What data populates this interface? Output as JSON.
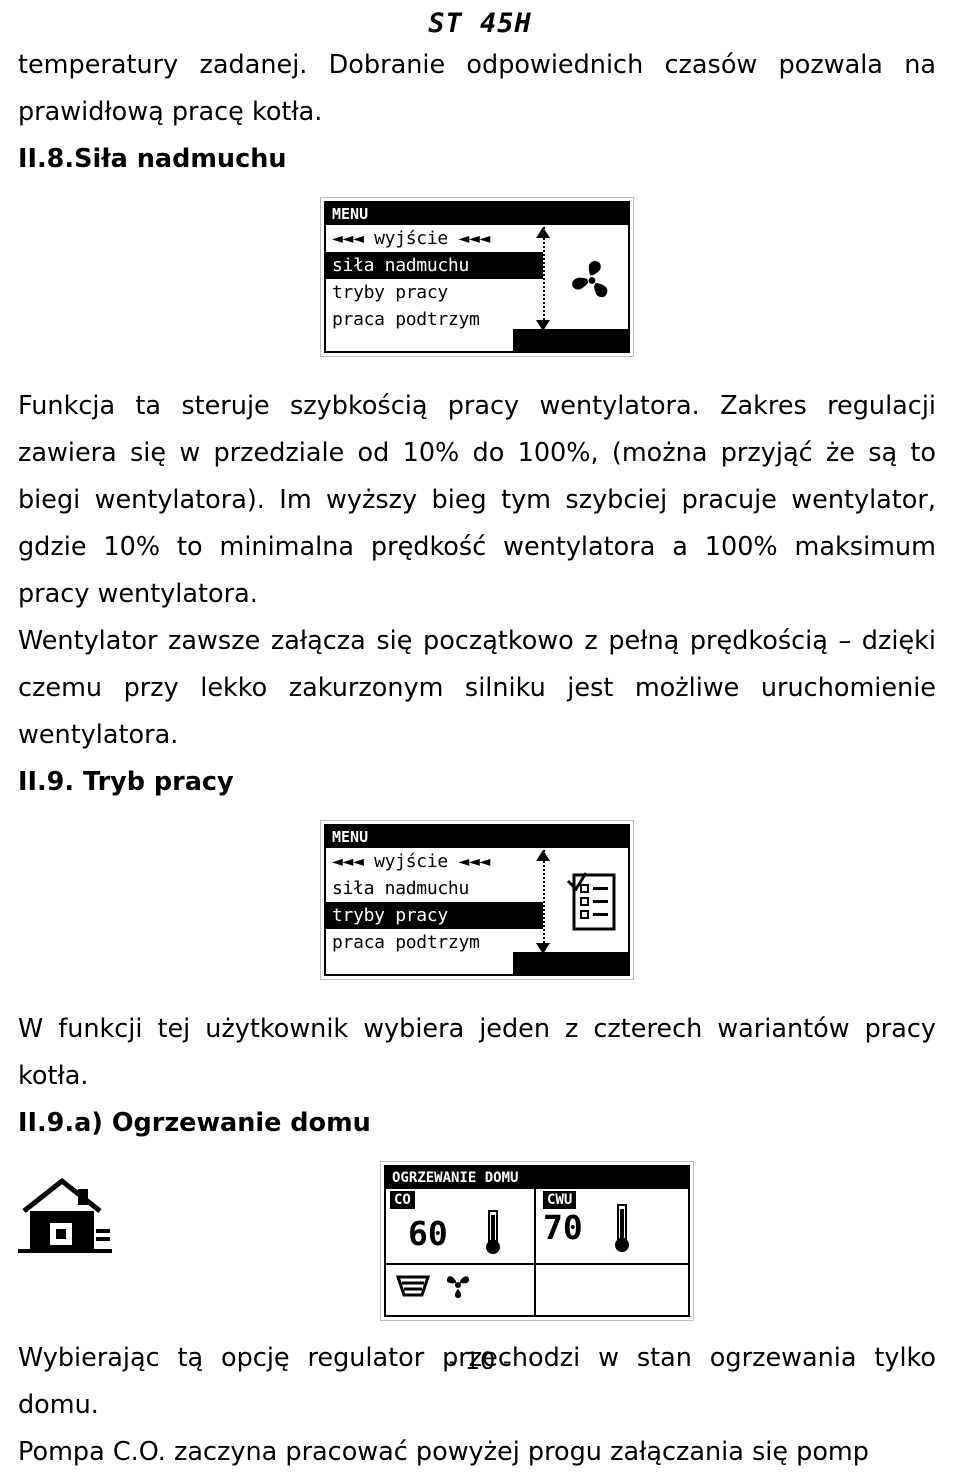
{
  "header": {
    "logo": "ST  45H"
  },
  "paragraphs": {
    "p1": "temperatury zadanej. Dobranie odpowiednich czasów pozwala na prawidłową pracę kotła.",
    "h_II8": "II.8.Siła nadmuchu",
    "p2": "Funkcja ta steruje szybkością pracy wentylatora. Zakres regulacji zawiera się w przedziale od 10% do 100%, (można przyjąć że są to biegi wentylatora). Im wyższy bieg tym szybciej pracuje wentylator, gdzie 10% to minimalna prędkość wentylatora a    100% maksimum pracy wentylatora.",
    "p3": "Wentylator zawsze załącza się początkowo z pełną prędkością – dzięki czemu przy lekko zakurzonym silniku jest możliwe uruchomienie wentylatora.",
    "h_II9": "II.9. Tryb pracy",
    "p4": "W funkcji tej użytkownik wybiera jeden z czterech wariantów pracy kotła.",
    "h_II9a": "II.9.a) Ogrzewanie domu",
    "p5": "Wybierając tą opcję regulator przechodzi w stan ogrzewania tylko domu.",
    "p6": "Pompa C.O. zaczyna pracować powyżej progu załączania się pomp"
  },
  "lcd_menu_fan": {
    "title": "MENU",
    "items": [
      {
        "label": "◄◄◄ wyjście ◄◄◄",
        "selected": false
      },
      {
        "label": "siła nadmuchu",
        "selected": true
      },
      {
        "label": "tryby pracy",
        "selected": false
      },
      {
        "label": "praca podtrzym",
        "selected": false
      }
    ],
    "icon": "fan-icon",
    "scroll_up": "▲",
    "scroll_down": "▼"
  },
  "lcd_menu_mode": {
    "title": "MENU",
    "items": [
      {
        "label": "◄◄◄ wyjście ◄◄◄",
        "selected": false
      },
      {
        "label": "siła nadmuchu",
        "selected": false
      },
      {
        "label": "tryby pracy",
        "selected": true
      },
      {
        "label": "praca podtrzym",
        "selected": false
      }
    ],
    "icon": "list-icon",
    "scroll_up": "▲",
    "scroll_down": "▼"
  },
  "lcd_heating": {
    "title": "OGRZEWANIE DOMU",
    "left_label": "CO",
    "right_label": "CWU",
    "left_value": "60",
    "right_value": "70",
    "pump_icon": "pump-icon",
    "fan_icon": "fan-icon",
    "left_thermometer": "thermometer-icon",
    "right_thermometer": "thermometer-icon"
  },
  "house_icon": "house-icon",
  "footer": {
    "page": "- 10 -"
  }
}
